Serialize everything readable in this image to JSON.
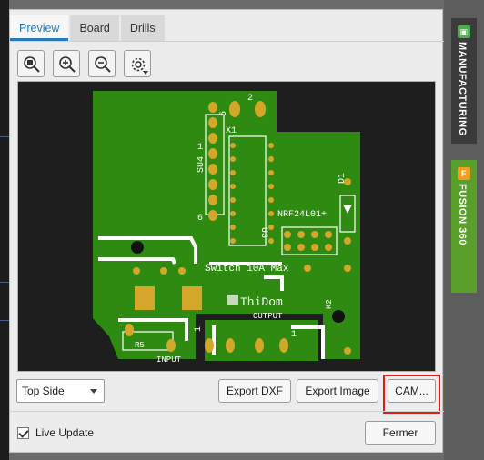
{
  "dialog": {
    "tabs": [
      {
        "label": "Preview",
        "active": true
      },
      {
        "label": "Board",
        "active": false
      },
      {
        "label": "Drills",
        "active": false
      }
    ],
    "toolbar": [
      {
        "name": "zoom-fit",
        "icon": "zoom-fit-icon"
      },
      {
        "name": "zoom-in",
        "icon": "zoom-in-icon"
      },
      {
        "name": "zoom-out",
        "icon": "zoom-out-icon"
      },
      {
        "name": "settings",
        "icon": "gear-icon"
      }
    ],
    "side_select": {
      "value": "Top Side"
    },
    "buttons": {
      "export_dxf": "Export DXF",
      "export_image": "Export Image",
      "cam": "CAM..."
    },
    "live_update": {
      "label": "Live Update",
      "checked": true
    },
    "close_button": "Fermer"
  },
  "side_tabs": [
    {
      "label": "MANUFACTURING",
      "icon": "chip-icon"
    },
    {
      "label": "FUSION 360",
      "icon": "fusion-f-icon"
    }
  ],
  "board": {
    "labels": {
      "u4": "SU4",
      "x1": "X1",
      "u3": "U3",
      "nrf": "NRF24L01+",
      "d1": "D1",
      "switch": "Switch 10A Max",
      "thidom": "ThiDom",
      "output": "OUTPUT",
      "r5": "R5",
      "input": "INPUT",
      "k2": "K2",
      "pin1": "1",
      "pin2": "2",
      "pin6": "6",
      "pin5": "5",
      "pin1b": "1",
      "pin1c": "1"
    }
  },
  "colors": {
    "board_green": "#2f8a12",
    "copper_gold": "#d4a72a",
    "silk_white": "#ffffff",
    "highlight_red": "#e01b1b",
    "accent_blue": "#2a7ab8"
  }
}
